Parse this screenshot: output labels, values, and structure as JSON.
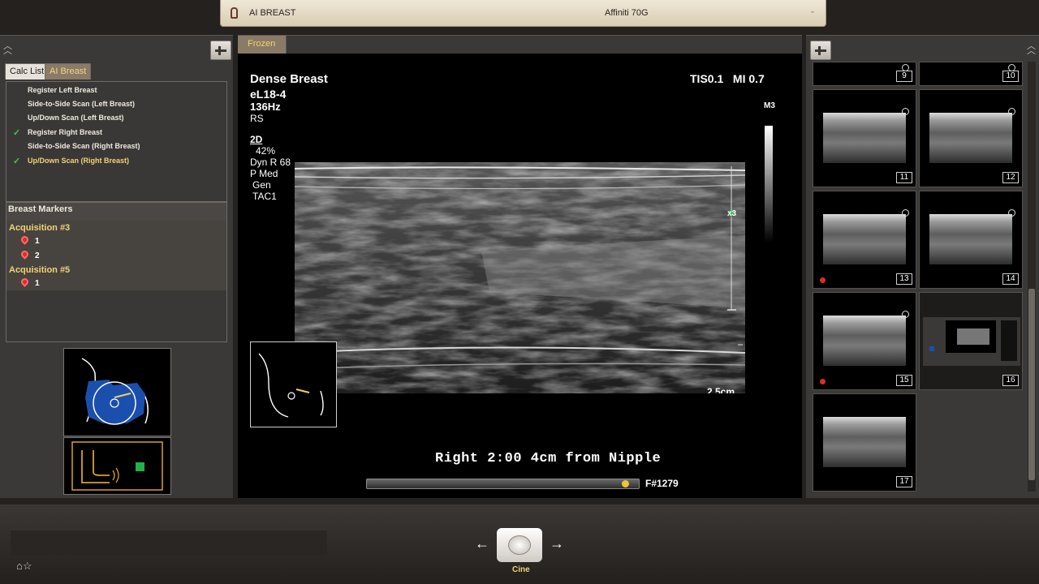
{
  "titlebar": {
    "app_name": "AI BREAST",
    "device": "Affiniti 70G",
    "icon": "person-icon"
  },
  "left_panel": {
    "tabs": [
      {
        "label": "Calc List"
      },
      {
        "label": "AI Breast"
      }
    ],
    "steps": [
      {
        "label": "Register Left Breast",
        "done": false
      },
      {
        "label": "Side-to-Side Scan (Left Breast)",
        "done": false
      },
      {
        "label": "Up/Down Scan (Left Breast)",
        "done": false
      },
      {
        "label": "Register Right Breast",
        "done": true
      },
      {
        "label": "Side-to-Side Scan (Right Breast)",
        "done": false
      },
      {
        "label": "Up/Down Scan (Right Breast)",
        "done": true
      }
    ],
    "markers_title": "Breast Markers",
    "acquisitions": [
      {
        "label": "Acquisition #3",
        "markers": [
          "1",
          "2"
        ]
      },
      {
        "label": "Acquisition #5",
        "markers": [
          "1"
        ]
      }
    ]
  },
  "center": {
    "tab": "Frozen",
    "preset": "Dense Breast",
    "probe": "eL18-4",
    "frame_rate": "136Hz",
    "mode_code": "RS",
    "tis_mi": "TIS0.1   MI 0.7",
    "map": "M3",
    "mode": "2D",
    "gain": "42%",
    "dyn_range": "Dyn R 68",
    "p_med": "P Med",
    "gen": "Gen",
    "tac": "TAC1",
    "depth": "2.5cm",
    "zoom": "x3",
    "caption": "Right 2:00 4cm from Nipple",
    "frame": "F#1279",
    "cine_progress": 0.97
  },
  "thumbnails": [
    {
      "num": "9"
    },
    {
      "num": "10"
    },
    {
      "num": "11"
    },
    {
      "num": "12"
    },
    {
      "num": "13",
      "marker": true
    },
    {
      "num": "14"
    },
    {
      "num": "15",
      "marker": true
    },
    {
      "num": "16"
    },
    {
      "num": "17"
    }
  ],
  "bottom": {
    "cine_label": "Cine",
    "left_arrow": "←",
    "right_arrow": "→"
  }
}
